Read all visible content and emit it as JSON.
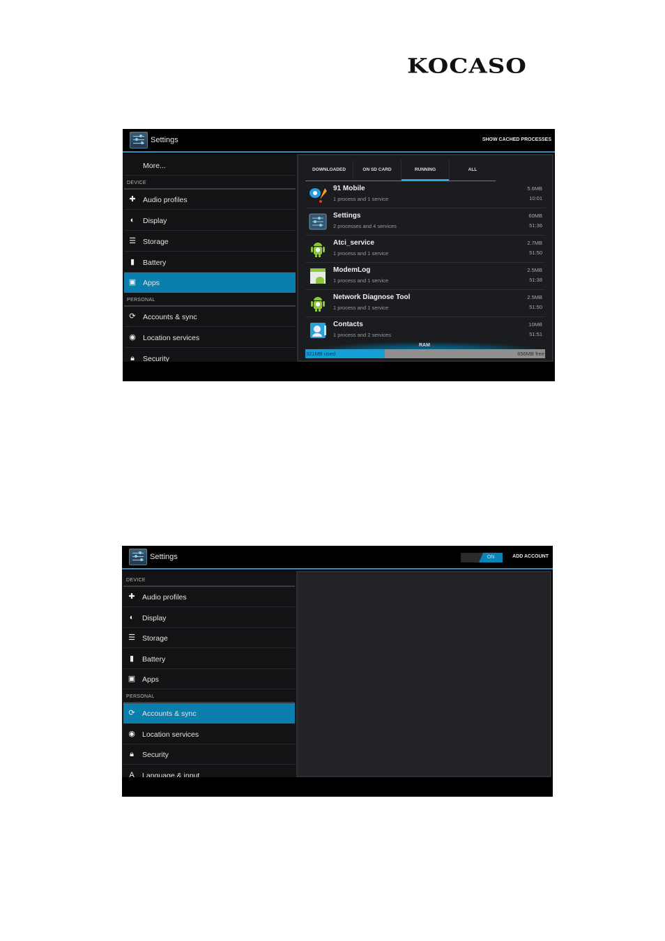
{
  "logo": "KOCASO",
  "screenshot1": {
    "title": "Settings",
    "action": "SHOW CACHED PROCESSES",
    "sidebar": {
      "more": "More...",
      "device_header": "DEVICE",
      "device_items": [
        "Audio profiles",
        "Display",
        "Storage",
        "Battery",
        "Apps"
      ],
      "personal_header": "PERSONAL",
      "personal_items": [
        "Accounts & sync",
        "Location services",
        "Security"
      ],
      "selected": "Apps"
    },
    "tabs": [
      "DOWNLOADED",
      "ON SD CARD",
      "RUNNING",
      "ALL"
    ],
    "selected_tab": "RUNNING",
    "processes": [
      {
        "name": "91 Mobile",
        "detail": "1 process and 1 service",
        "size": "5.6MB",
        "time": "10:01"
      },
      {
        "name": "Settings",
        "detail": "2 processes and 4 services",
        "size": "60MB",
        "time": "51:36"
      },
      {
        "name": "Atci_service",
        "detail": "1 process and 1 service",
        "size": "2.7MB",
        "time": "51:50"
      },
      {
        "name": "ModemLog",
        "detail": "1 process and 1 service",
        "size": "2.5MB",
        "time": "51:38"
      },
      {
        "name": "Network Diagnose Tool",
        "detail": "1 process and 1 service",
        "size": "2.5MB",
        "time": "51:50"
      },
      {
        "name": "Contacts",
        "detail": "1 process and 2 services",
        "size": "10MB",
        "time": "51:51"
      }
    ],
    "ram": {
      "label": "RAM",
      "used": "321MB used",
      "free": "656MB free",
      "used_fraction": 0.33
    }
  },
  "screenshot2": {
    "title": "Settings",
    "toggle": "ON",
    "action": "ADD ACCOUNT",
    "sidebar": {
      "device_header": "DEVICE",
      "device_items": [
        "Audio profiles",
        "Display",
        "Storage",
        "Battery",
        "Apps"
      ],
      "personal_header": "PERSONAL",
      "personal_items": [
        "Accounts & sync",
        "Location services",
        "Security",
        "Language & input"
      ],
      "selected": "Accounts & sync"
    }
  },
  "colors": {
    "accent": "#0a7fae",
    "highlight": "#33a7dc",
    "panel": "#1b1c1f"
  }
}
